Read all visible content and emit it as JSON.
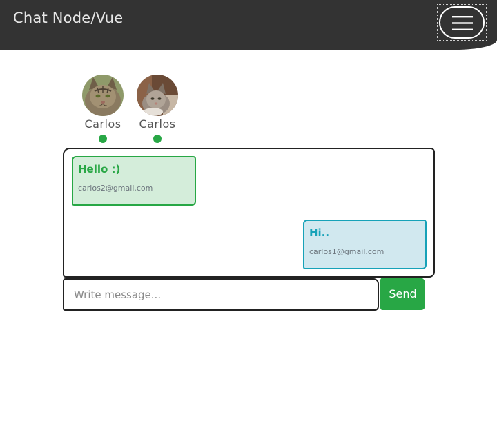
{
  "navbar": {
    "brand": "Chat Node/Vue",
    "toggler_icon": "hamburger-menu-icon"
  },
  "users": [
    {
      "name": "Carlos",
      "status": "online",
      "avatar_icon": "cat-avatar"
    },
    {
      "name": "Carlos",
      "status": "online",
      "avatar_icon": "cat-avatar"
    }
  ],
  "messages": [
    {
      "text": "Hello :)",
      "email": "carlos2@gmail.com",
      "side": "left"
    },
    {
      "text": "Hi..",
      "email": "carlos1@gmail.com",
      "side": "right"
    }
  ],
  "composer": {
    "placeholder": "Write message...",
    "value": "",
    "send_label": "Send"
  },
  "colors": {
    "navbar": "#333333",
    "online": "#28a745",
    "incoming_bg": "#d4edda",
    "incoming_border": "#28a745",
    "outgoing_bg": "#d1e8ef",
    "outgoing_border": "#17a2b8"
  }
}
